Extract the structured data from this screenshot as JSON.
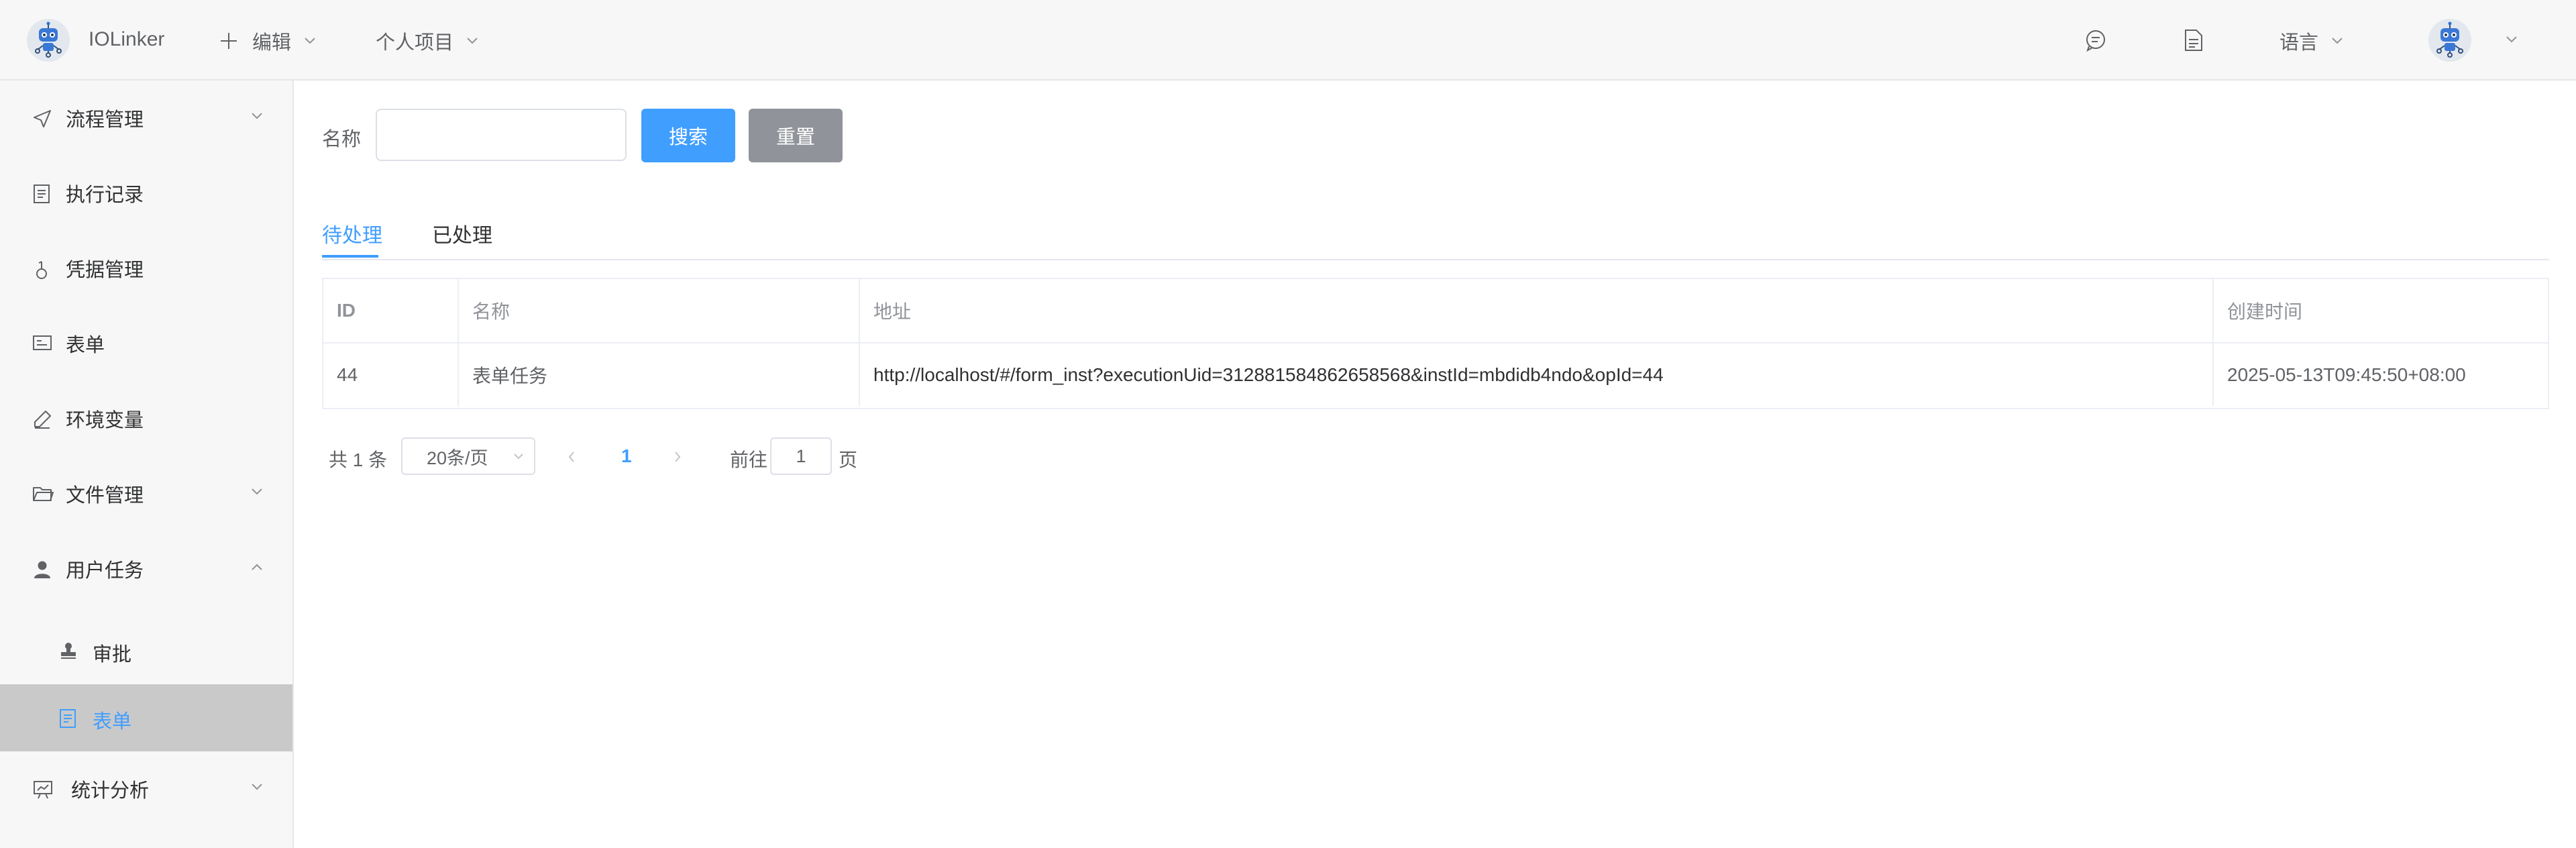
{
  "app": {
    "name": "IOLinker"
  },
  "header": {
    "edit_label": "编辑",
    "project_label": "个人项目",
    "language_label": "语言",
    "icons": [
      "plus-icon",
      "chat-icon",
      "document-icon",
      "robot-avatar-icon"
    ]
  },
  "sidebar": {
    "items": [
      {
        "label": "流程管理",
        "icon": "send-icon",
        "expandable": true
      },
      {
        "label": "执行记录",
        "icon": "list-doc-icon"
      },
      {
        "label": "凭据管理",
        "icon": "key-icon"
      },
      {
        "label": "表单",
        "icon": "form-icon"
      },
      {
        "label": "环境变量",
        "icon": "pen-icon"
      },
      {
        "label": "文件管理",
        "icon": "folder-icon",
        "expandable": true
      },
      {
        "label": "用户任务",
        "icon": "user-icon",
        "expanded": true
      },
      {
        "label": "统计分析",
        "icon": "chart-icon",
        "expandable": true
      }
    ],
    "sub_items": [
      {
        "label": "审批",
        "icon": "stamp-icon"
      },
      {
        "label": "表单",
        "icon": "form-doc-icon",
        "active": true
      }
    ]
  },
  "search": {
    "label": "名称",
    "value": "",
    "search_button": "搜索",
    "reset_button": "重置"
  },
  "tabs": [
    {
      "label": "待处理",
      "active": true
    },
    {
      "label": "已处理",
      "active": false
    }
  ],
  "table": {
    "headers": [
      "ID",
      "名称",
      "地址",
      "创建时间"
    ],
    "rows": [
      {
        "id": "44",
        "name": "表单任务",
        "url": "http://localhost/#/form_inst?executionUid=312881584862658568&instId=mbdidb4ndo&opId=44",
        "created": "2025-05-13T09:45:50+08:00"
      }
    ]
  },
  "pagination": {
    "total": "共 1 条",
    "page_size": "20条/页",
    "current_page": "1",
    "goto_label": "前往",
    "goto_value": "1",
    "page_suffix": "页"
  },
  "colors": {
    "accent": "#409eff",
    "reset_button": "#909399",
    "active_menu_bg": "#c9c9c9"
  }
}
